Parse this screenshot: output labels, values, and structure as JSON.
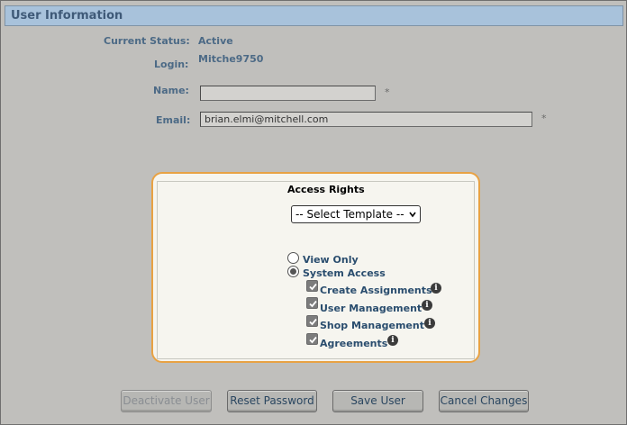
{
  "section": {
    "title": "User Information"
  },
  "status": {
    "label": "Current Status:",
    "value": "Active"
  },
  "login": {
    "label": "Login:",
    "value": "Mitche9750"
  },
  "name": {
    "label": "Name:",
    "value": "",
    "required": "*"
  },
  "email": {
    "label": "Email:",
    "value": "brian.elmi@mitchell.com",
    "required": "*"
  },
  "access": {
    "legend": "Access Rights",
    "template_select": {
      "selected": "-- Select Template --"
    },
    "modes": [
      {
        "label": "View Only",
        "checked": false
      },
      {
        "label": "System Access",
        "checked": true
      }
    ],
    "permissions": [
      {
        "label": "Create Assignments",
        "checked": true,
        "icon": "info-icon"
      },
      {
        "label": "User Management",
        "checked": true,
        "icon": "info-icon"
      },
      {
        "label": "Shop Management",
        "checked": true,
        "icon": "info-icon"
      },
      {
        "label": "Agreements",
        "checked": true,
        "icon": "info-icon"
      }
    ]
  },
  "buttons": {
    "deactivate": "Deactivate User",
    "reset": "Reset Password",
    "save": "Save User",
    "cancel": "Cancel Changes"
  },
  "colors": {
    "header_bg": "#a8c2db",
    "accent_border": "#e8a244",
    "label_text": "#4c6a86"
  }
}
